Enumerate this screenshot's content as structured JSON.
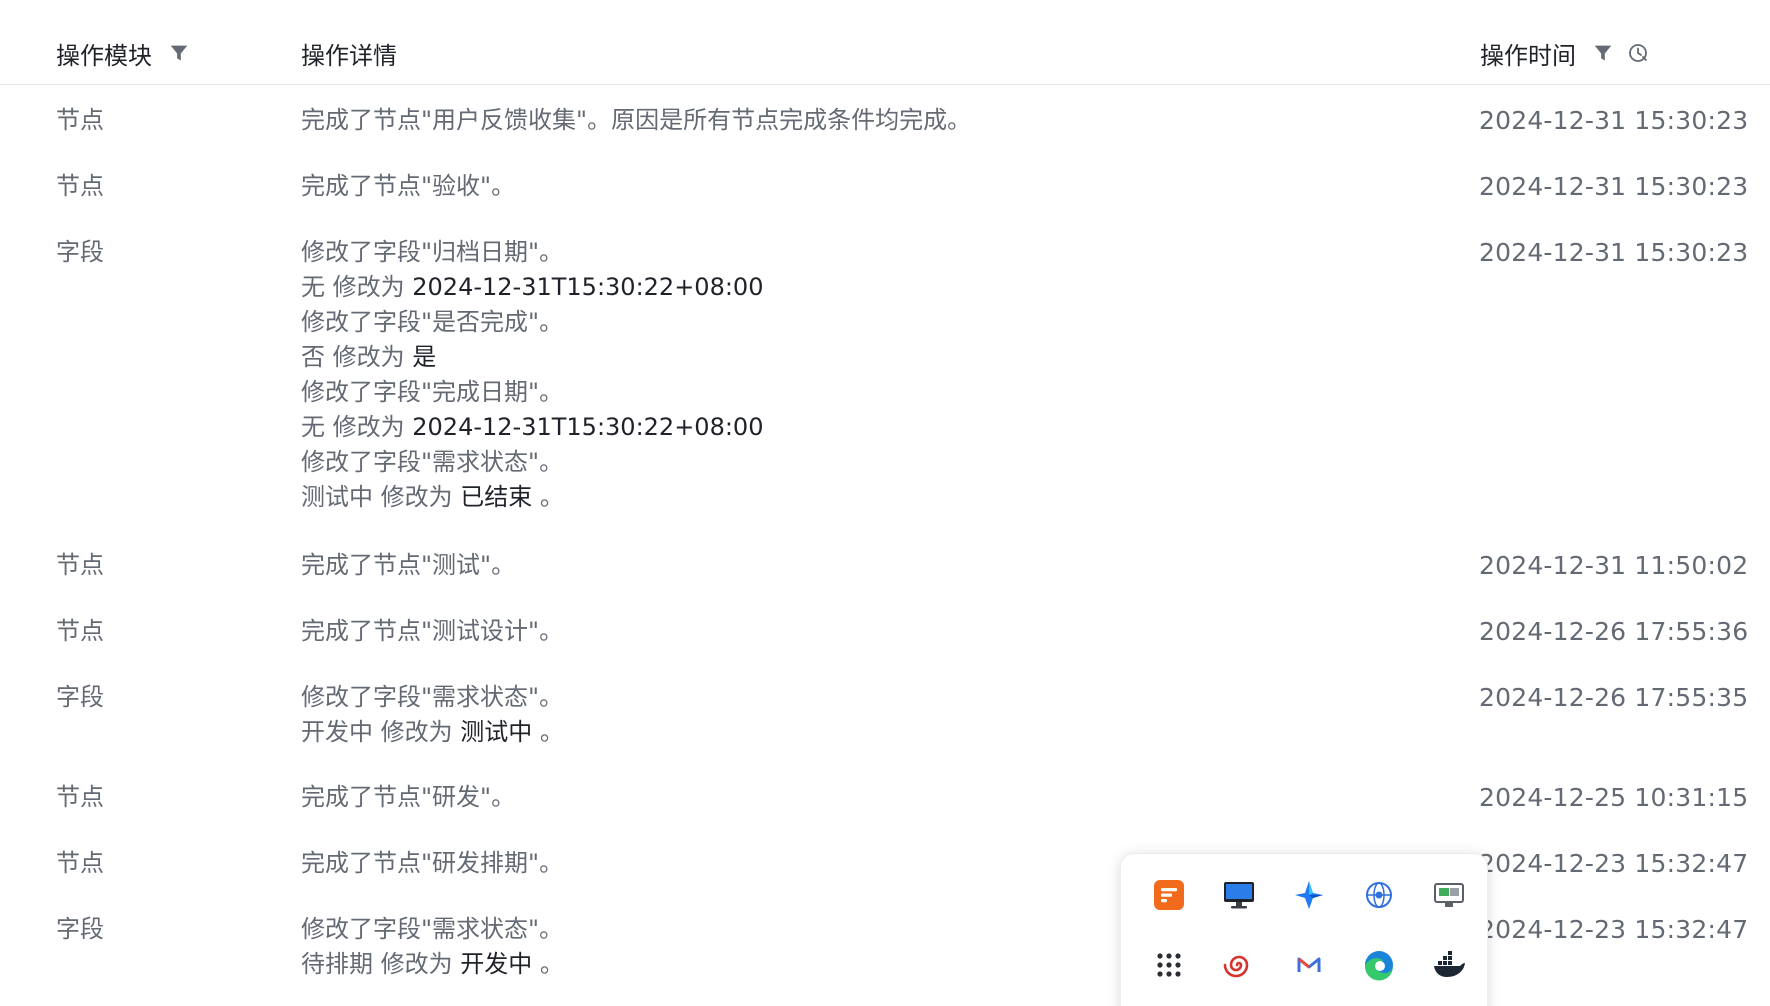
{
  "header": {
    "module": "操作模块",
    "detail": "操作详情",
    "time": "操作时间"
  },
  "rows": [
    {
      "module": "节点",
      "lines": [
        {
          "text": "完成了节点\"用户反馈收集\"。原因是所有节点完成条件均完成。"
        }
      ],
      "time": "2024-12-31 15:30:23"
    },
    {
      "module": "节点",
      "lines": [
        {
          "text": "完成了节点\"验收\"。"
        }
      ],
      "time": "2024-12-31 15:30:23"
    },
    {
      "module": "字段",
      "lines": [
        {
          "text": "修改了字段\"归档日期\"。"
        },
        {
          "prefix": "无 修改为 ",
          "value": "2024-12-31T15:30:22+08:00",
          "suffix": ""
        },
        {
          "text": "修改了字段\"是否完成\"。"
        },
        {
          "prefix": "否 修改为 ",
          "value": "是",
          "suffix": ""
        },
        {
          "text": "修改了字段\"完成日期\"。"
        },
        {
          "prefix": "无 修改为 ",
          "value": "2024-12-31T15:30:22+08:00",
          "suffix": ""
        },
        {
          "text": "修改了字段\"需求状态\"。"
        },
        {
          "prefix": "测试中 修改为 ",
          "value": "已结束",
          "suffix": " 。"
        }
      ],
      "time": "2024-12-31 15:30:23"
    },
    {
      "module": "节点",
      "lines": [
        {
          "text": "完成了节点\"测试\"。"
        }
      ],
      "time": "2024-12-31 11:50:02"
    },
    {
      "module": "节点",
      "lines": [
        {
          "text": "完成了节点\"测试设计\"。"
        }
      ],
      "time": "2024-12-26 17:55:36"
    },
    {
      "module": "字段",
      "lines": [
        {
          "text": "修改了字段\"需求状态\"。"
        },
        {
          "prefix": "开发中 修改为 ",
          "value": "测试中",
          "suffix": " 。"
        }
      ],
      "time": "2024-12-26 17:55:35"
    },
    {
      "module": "节点",
      "lines": [
        {
          "text": "完成了节点\"研发\"。"
        }
      ],
      "time": "2024-12-25 10:31:15"
    },
    {
      "module": "节点",
      "lines": [
        {
          "text": "完成了节点\"研发排期\"。"
        }
      ],
      "time": "2024-12-23 15:32:47"
    },
    {
      "module": "字段",
      "lines": [
        {
          "text": "修改了字段\"需求状态\"。"
        },
        {
          "prefix": "待排期 修改为 ",
          "value": "开发中",
          "suffix": " 。"
        }
      ],
      "time": "2024-12-23 15:32:47"
    }
  ],
  "dock": {
    "apps": [
      "orange-doc-app-icon",
      "monitor-app-icon",
      "blue-star-app-icon",
      "network-globe-app-icon",
      "remote-desktop-app-icon",
      "app-grid-icon",
      "red-spiral-app-icon",
      "mail-app-icon",
      "edge-browser-icon",
      "docker-icon"
    ]
  },
  "colors": {
    "text_primary": "#1f2329",
    "text_secondary": "#646a73",
    "divider": "#e5e6eb"
  }
}
